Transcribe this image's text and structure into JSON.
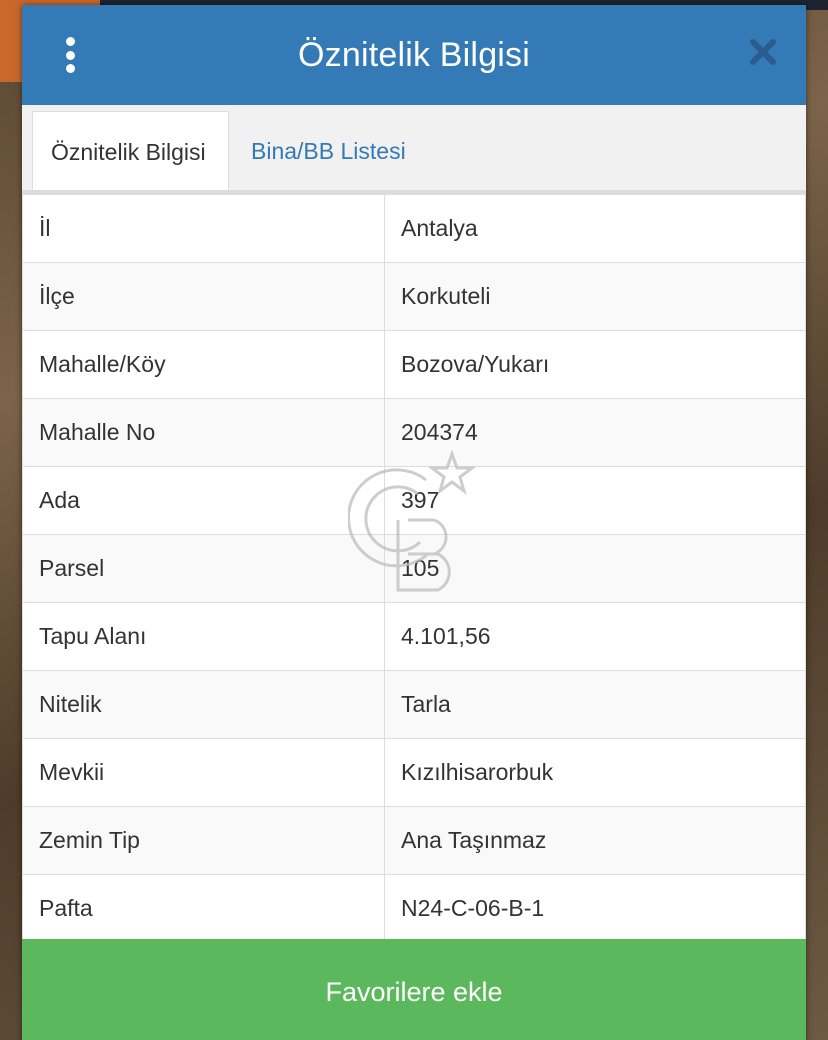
{
  "header": {
    "title": "Öznitelik Bilgisi",
    "menu_icon": "kebab-menu-icon",
    "close_icon": "close-icon"
  },
  "tabs": [
    {
      "label": "Öznitelik Bilgisi",
      "active": true
    },
    {
      "label": "Bina/BB Listesi",
      "active": false
    }
  ],
  "attributes": [
    {
      "key": "İl",
      "value": "Antalya"
    },
    {
      "key": "İlçe",
      "value": "Korkuteli"
    },
    {
      "key": "Mahalle/Köy",
      "value": "Bozova/Yukarı"
    },
    {
      "key": "Mahalle No",
      "value": "204374"
    },
    {
      "key": "Ada",
      "value": "397"
    },
    {
      "key": "Parsel",
      "value": "105"
    },
    {
      "key": "Tapu Alanı",
      "value": "4.101,56"
    },
    {
      "key": "Nitelik",
      "value": "Tarla"
    },
    {
      "key": "Mevkii",
      "value": "Kızılhisarorbuk"
    },
    {
      "key": "Zemin Tip",
      "value": "Ana Taşınmaz"
    },
    {
      "key": "Pafta",
      "value": "N24-C-06-B-1"
    }
  ],
  "footer": {
    "favorite_label": "Favorilere ekle"
  },
  "watermark": {
    "icon": "cb-logo-watermark-icon"
  },
  "colors": {
    "header_blue": "#337ab7",
    "link_blue": "#337ab7",
    "button_green": "#5cb85c"
  }
}
